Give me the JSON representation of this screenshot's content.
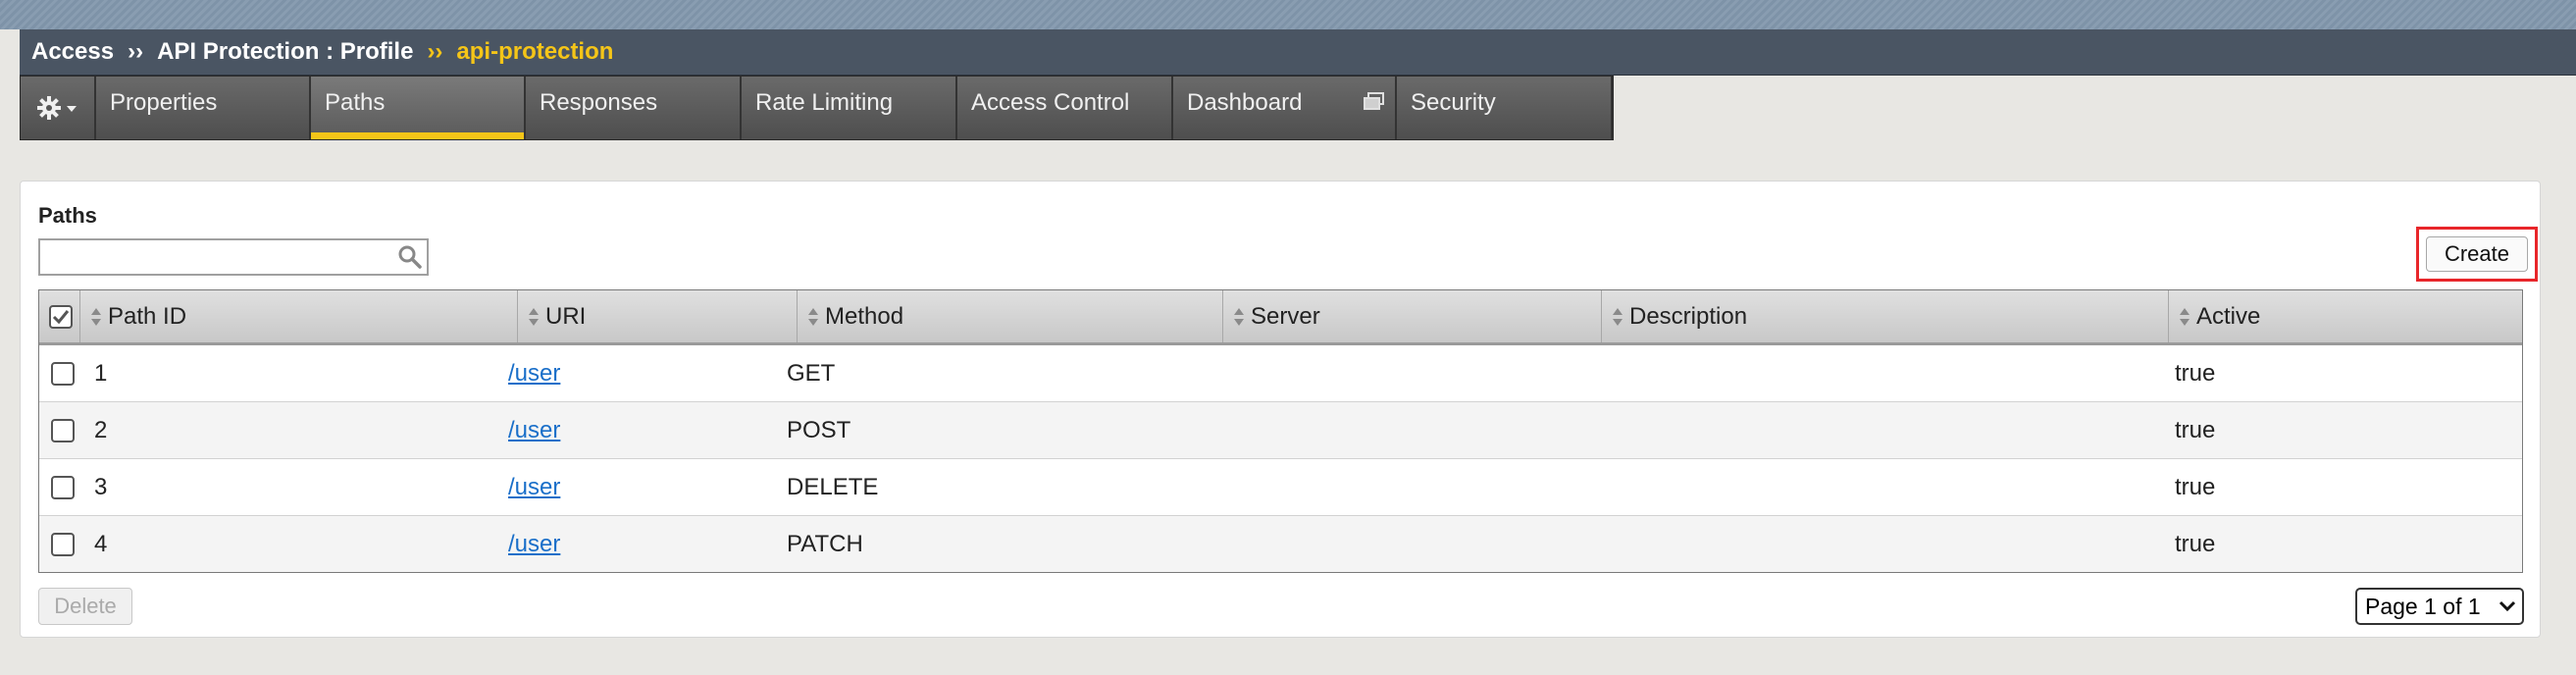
{
  "breadcrumb": {
    "root": "Access",
    "section": "API Protection : Profile",
    "current": "api-protection",
    "separator": "››"
  },
  "tabs": [
    {
      "label": "Properties"
    },
    {
      "label": "Paths"
    },
    {
      "label": "Responses"
    },
    {
      "label": "Rate Limiting"
    },
    {
      "label": "Access Control"
    },
    {
      "label": "Dashboard"
    },
    {
      "label": "Security"
    }
  ],
  "active_tab": "Paths",
  "panel": {
    "title": "Paths",
    "search_value": "",
    "create_label": "Create",
    "delete_label": "Delete",
    "pager_label": "Page 1 of 1"
  },
  "table": {
    "columns": [
      "Path ID",
      "URI",
      "Method",
      "Server",
      "Description",
      "Active"
    ],
    "rows": [
      {
        "path_id": "1",
        "uri": "/user",
        "method": "GET",
        "server": "",
        "description": "",
        "active": "true"
      },
      {
        "path_id": "2",
        "uri": "/user",
        "method": "POST",
        "server": "",
        "description": "",
        "active": "true"
      },
      {
        "path_id": "3",
        "uri": "/user",
        "method": "DELETE",
        "server": "",
        "description": "",
        "active": "true"
      },
      {
        "path_id": "4",
        "uri": "/user",
        "method": "PATCH",
        "server": "",
        "description": "",
        "active": "true"
      }
    ]
  },
  "colors": {
    "breadcrumb_bg": "#4a5563",
    "accent_gold": "#f5c518",
    "highlight_red": "#e8262a",
    "link_blue": "#1a6fc9"
  },
  "icons": {
    "tab_menu": "gear-icon",
    "dashboard_tab": "external-window-icon",
    "search": "search-icon",
    "sort": "sort-arrows-icon",
    "pager": "chevron-down-icon"
  }
}
